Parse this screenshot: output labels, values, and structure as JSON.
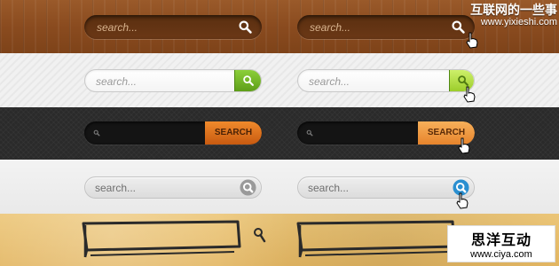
{
  "watermark": {
    "line1": "互联网的一些事",
    "line2": "www.yixieshi.com"
  },
  "logo": {
    "line1": "思洋互动",
    "line2": "www.ciya.com"
  },
  "wood": {
    "placeholder": "search...",
    "placeholder_hover": "search..."
  },
  "light": {
    "placeholder": "search...",
    "placeholder_hover": "search..."
  },
  "dark": {
    "button_label": "SEARCH",
    "button_label_hover": "SEARCH"
  },
  "gray": {
    "placeholder": "search...",
    "placeholder_hover": "search..."
  },
  "colors": {
    "wood_bg": "#8a4b1f",
    "green_button": "#5e9e18",
    "green_button_hover": "#cdf06a",
    "orange_button": "#c85a10",
    "orange_button_hover": "#f7b05a",
    "blue_hover_icon": "#2a8fd0",
    "paper_bg": "#e3b662"
  },
  "icons": [
    "magnifier-icon",
    "hand-cursor-icon"
  ]
}
